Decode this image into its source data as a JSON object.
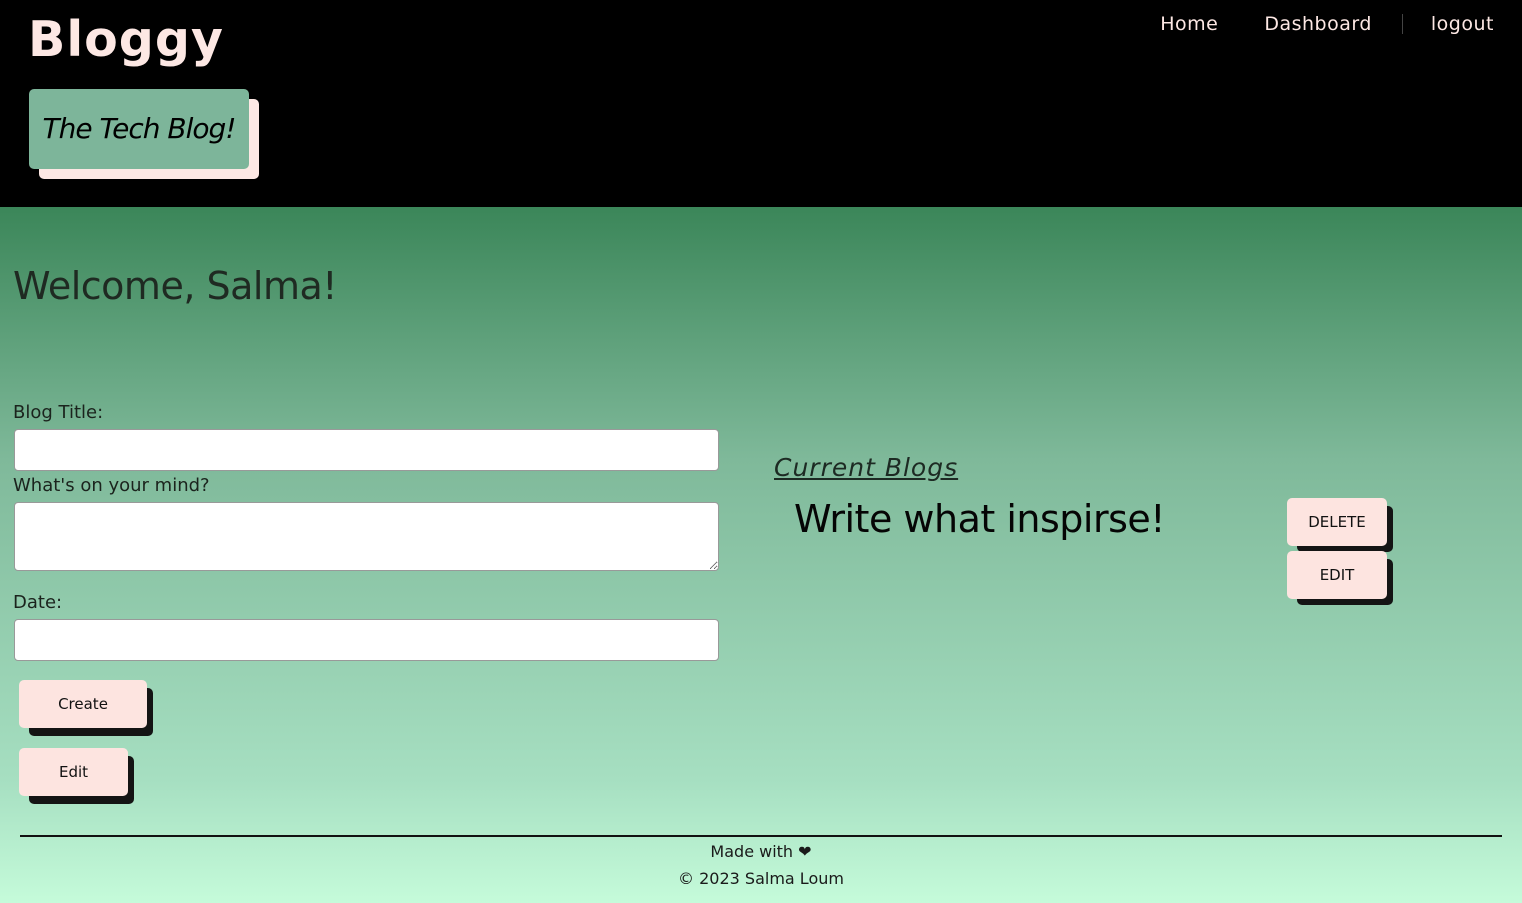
{
  "header": {
    "logo": "Bloggy",
    "tagline": "The Tech Blog!",
    "nav": {
      "home": "Home",
      "dashboard": "Dashboard",
      "logout": "logout"
    }
  },
  "main": {
    "welcome": "Welcome, Salma!",
    "form": {
      "title_label": "Blog Title:",
      "title_value": "",
      "content_label": "What's on your mind?",
      "content_value": "",
      "date_label": "Date:",
      "date_value": "",
      "create_label": "Create",
      "edit_label": "Edit"
    },
    "blogs": {
      "heading": "Current Blogs",
      "items": [
        {
          "title": "Write what inspirse!",
          "delete_label": "DELETE",
          "edit_label": "EDIT"
        }
      ]
    }
  },
  "footer": {
    "made_with": "Made with ❤",
    "copyright": "© 2023 Salma Loum"
  },
  "colors": {
    "header_bg": "#000000",
    "logo_text": "#fde8e4",
    "tagline_bg": "#7db59a",
    "button_bg": "#fde4e0",
    "button_shadow": "#141414",
    "gradient_top": "#3b8659",
    "gradient_bottom": "#c5fbda"
  }
}
